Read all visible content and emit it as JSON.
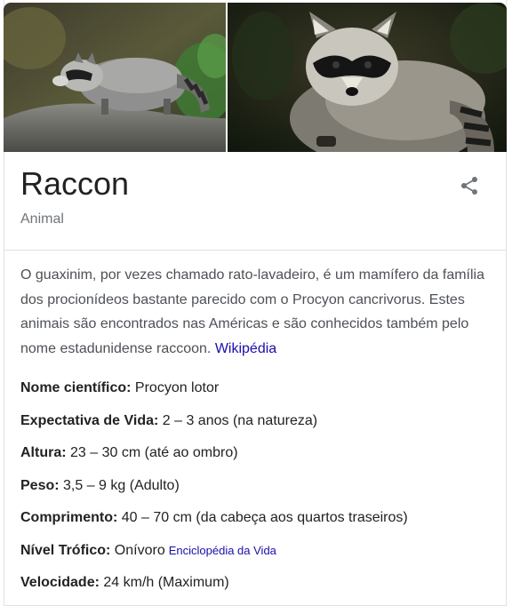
{
  "images": {
    "left_icon": "raccoon-walking-photo",
    "right_icon": "raccoon-closeup-photo"
  },
  "header": {
    "title": "Raccon",
    "subtitle": "Animal",
    "share_icon": "share-icon"
  },
  "description": {
    "text": "O guaxinim, por vezes chamado rato-lavadeiro, é um mamífero da família dos procionídeos bastante parecido com o Procyon cancrivorus. Estes animais são encontrados nas Américas e são conhecidos também pelo nome estadunidense raccoon. ",
    "source_link": "Wikipédia"
  },
  "facts": [
    {
      "key": "Nome científico:",
      "value": " Procyon lotor"
    },
    {
      "key": "Expectativa de Vida:",
      "value": " 2 – 3 anos (na natureza)"
    },
    {
      "key": "Altura:",
      "value": " 23 – 30 cm (até ao ombro)"
    },
    {
      "key": "Peso:",
      "value": " 3,5 – 9 kg (Adulto)"
    },
    {
      "key": "Comprimento:",
      "value": " 40 – 70 cm (da cabeça aos quartos traseiros)"
    },
    {
      "key": "Nível Trófico:",
      "value": " Onívoro",
      "source": "Enciclopédia da Vida"
    },
    {
      "key": "Velocidade:",
      "value": " 24 km/h (Maximum)"
    }
  ],
  "colors": {
    "title": "#222222",
    "subtitle": "#70757a",
    "link": "#1a0dab",
    "border": "#dfe1e5"
  }
}
